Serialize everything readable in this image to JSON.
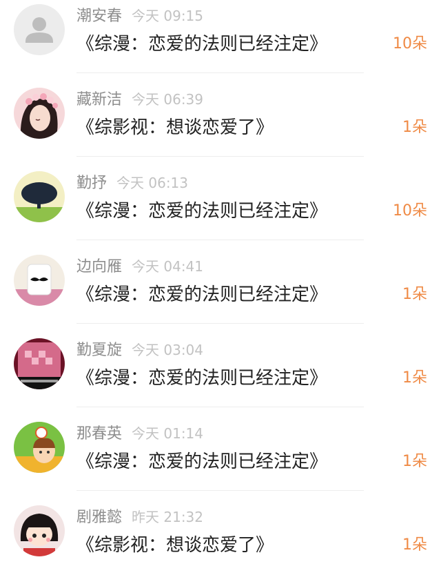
{
  "accent_color": "#ef8a45",
  "items": [
    {
      "avatar": "default-user-avatar",
      "name": "潮安春",
      "time": "今天 09:15",
      "title": "《综漫：恋爱的法则已经注定》",
      "count": "10朵"
    },
    {
      "avatar": "flower-crown-girl-avatar",
      "name": "藏新洁",
      "time": "今天 06:39",
      "title": "《综影视：想谈恋爱了》",
      "count": "1朵"
    },
    {
      "avatar": "tree-avatar",
      "name": "勤抒",
      "time": "今天 06:13",
      "title": "《综漫：恋爱的法则已经注定》",
      "count": "10朵"
    },
    {
      "avatar": "milk-mustache-avatar",
      "name": "边向雁",
      "time": "今天 04:41",
      "title": "《综漫：恋爱的法则已经注定》",
      "count": "1朵"
    },
    {
      "avatar": "pink-pixel-heart-avatar",
      "name": "勤夏旋",
      "time": "今天 03:04",
      "title": "《综漫：恋爱的法则已经注定》",
      "count": "1朵"
    },
    {
      "avatar": "cartoon-girl-clock-avatar",
      "name": "那春英",
      "time": "今天 01:14",
      "title": "《综漫：恋爱的法则已经注定》",
      "count": "1朵"
    },
    {
      "avatar": "chibi-girl-avatar",
      "name": "剧雅懿",
      "time": "昨天 21:32",
      "title": "《综影视：想谈恋爱了》",
      "count": "1朵"
    }
  ]
}
